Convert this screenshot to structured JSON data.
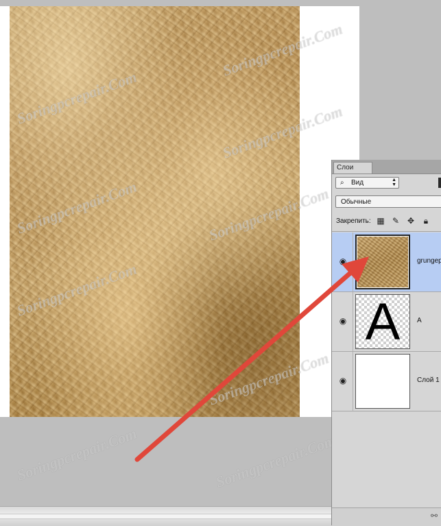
{
  "layers_panel": {
    "tab_label": "Слои",
    "filter_label": "Вид",
    "blend_mode": "Обычные",
    "lock_label": "Закрепить:",
    "lock_icons": [
      "transparency-lock-icon",
      "brush-lock-icon",
      "move-lock-icon",
      "padlock-icon"
    ],
    "layers": [
      {
        "name": "grungep",
        "thumb": "texture",
        "selected": true
      },
      {
        "name": "A",
        "thumb": "letter",
        "glyph": "A",
        "selected": false
      },
      {
        "name": "Слой 1",
        "thumb": "white",
        "selected": false
      }
    ]
  },
  "watermark_text": "Soringpcrepair.Com",
  "colors": {
    "selection": "#b7cdf3",
    "arrow": "#e0473a",
    "workspace": "#bebebe"
  }
}
